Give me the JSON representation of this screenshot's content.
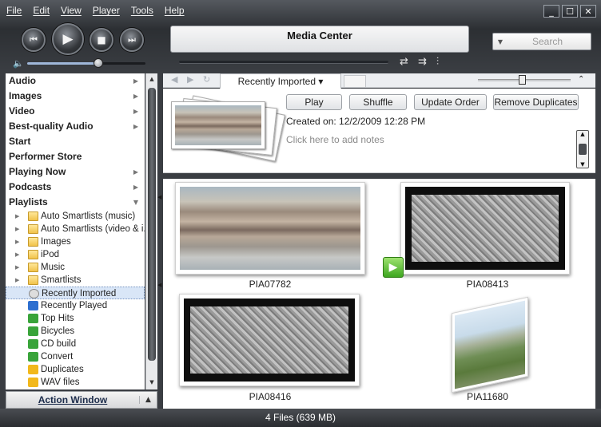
{
  "menu": [
    "File",
    "Edit",
    "View",
    "Player",
    "Tools",
    "Help"
  ],
  "window_buttons": {
    "minimize": "_",
    "maximize": "☐",
    "close": "✕"
  },
  "transport": {
    "prev": "⏮",
    "play": "▶",
    "stop": "■",
    "next": "⏭"
  },
  "volume": {
    "icon": "🔈",
    "level": 0.6
  },
  "display": {
    "title": "Media Center"
  },
  "mode_icons": [
    "⇄",
    "⇉",
    "⫶"
  ],
  "search": {
    "placeholder": "Search",
    "arrow": "▼"
  },
  "tree": {
    "top_items": [
      {
        "label": "Audio",
        "arrow": "▶"
      },
      {
        "label": "Images",
        "arrow": "▶"
      },
      {
        "label": "Video",
        "arrow": "▶"
      },
      {
        "label": "Best-quality Audio",
        "arrow": "▶"
      },
      {
        "label": "Start",
        "arrow": ""
      },
      {
        "label": "Performer Store",
        "arrow": ""
      },
      {
        "label": "Playing Now",
        "arrow": "▶"
      },
      {
        "label": "Podcasts",
        "arrow": "▶"
      },
      {
        "label": "Playlists",
        "arrow": "▼"
      }
    ],
    "playlists": [
      {
        "label": "Auto Smartlists (music)",
        "icon": "folder",
        "expander": "▶"
      },
      {
        "label": "Auto Smartlists (video & i...",
        "icon": "folder",
        "expander": "▶"
      },
      {
        "label": "Images",
        "icon": "folder",
        "expander": "▶"
      },
      {
        "label": "iPod",
        "icon": "folder",
        "expander": "▶"
      },
      {
        "label": "Music",
        "icon": "folder",
        "expander": "▶"
      },
      {
        "label": "Smartlists",
        "icon": "folder",
        "expander": "▶"
      },
      {
        "label": "Recently Imported",
        "icon": "clock",
        "expander": ""
      },
      {
        "label": "Recently Played",
        "icon": "blue",
        "expander": ""
      },
      {
        "label": "Top Hits",
        "icon": "green",
        "expander": ""
      },
      {
        "label": "Bicycles",
        "icon": "green",
        "expander": ""
      },
      {
        "label": "CD build",
        "icon": "green",
        "expander": ""
      },
      {
        "label": "Convert",
        "icon": "green",
        "expander": ""
      },
      {
        "label": "Duplicates",
        "icon": "yellow",
        "expander": ""
      },
      {
        "label": "WAV files",
        "icon": "yellow",
        "expander": ""
      }
    ],
    "selected": "Recently Imported"
  },
  "action_window": {
    "label": "Action Window",
    "toggle": "▲"
  },
  "view": {
    "nav_back": "◀",
    "nav_forward": "▶",
    "nav_refresh": "↻",
    "tab_label": "Recently Imported ▾",
    "collapse": "⌃"
  },
  "info": {
    "buttons": [
      "Play",
      "Shuffle",
      "Update Order",
      "Remove Duplicates"
    ],
    "created": "Created on: 12/2/2009 12:28 PM",
    "notes_placeholder": "Click here to add notes"
  },
  "files": [
    {
      "name": "PIA07782",
      "kind": "jupiter"
    },
    {
      "name": "PIA08413",
      "kind": "map-dark"
    },
    {
      "name": "PIA08416",
      "kind": "map-dark"
    },
    {
      "name": "PIA11680",
      "kind": "landscape"
    }
  ],
  "status": "4 Files (639 MB)"
}
